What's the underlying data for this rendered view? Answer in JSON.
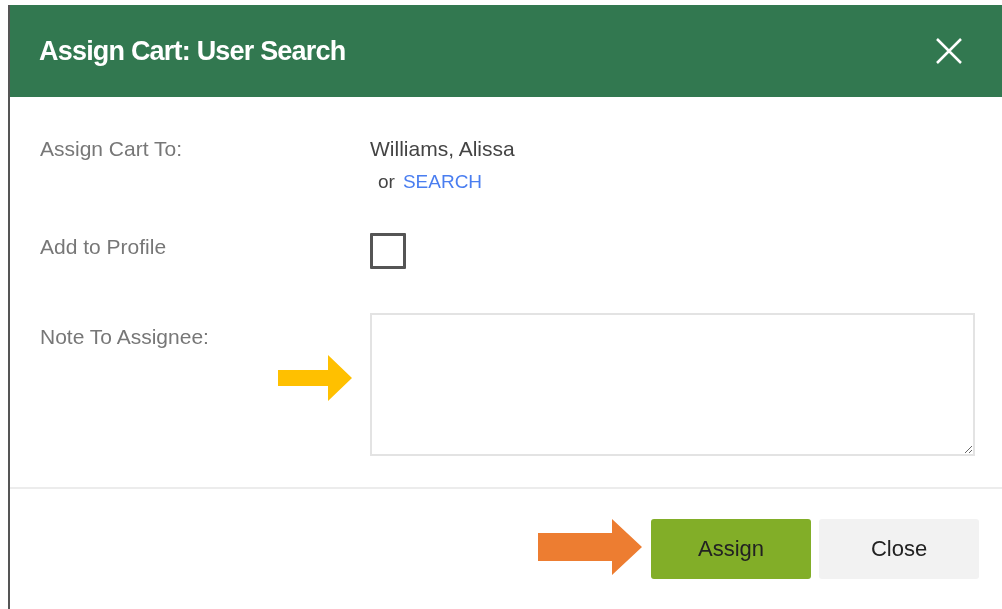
{
  "dialog": {
    "title": "Assign Cart: User Search",
    "assign_to": {
      "label": "Assign Cart To:",
      "value": "Williams, Alissa",
      "or_text": "or",
      "search_link": "SEARCH"
    },
    "add_to_profile": {
      "label": "Add to Profile",
      "checked": false
    },
    "note": {
      "label": "Note To Assignee:"
    },
    "buttons": [
      {
        "label": "Assign",
        "kind": "primary"
      },
      {
        "label": "Close",
        "kind": "secondary"
      }
    ]
  }
}
